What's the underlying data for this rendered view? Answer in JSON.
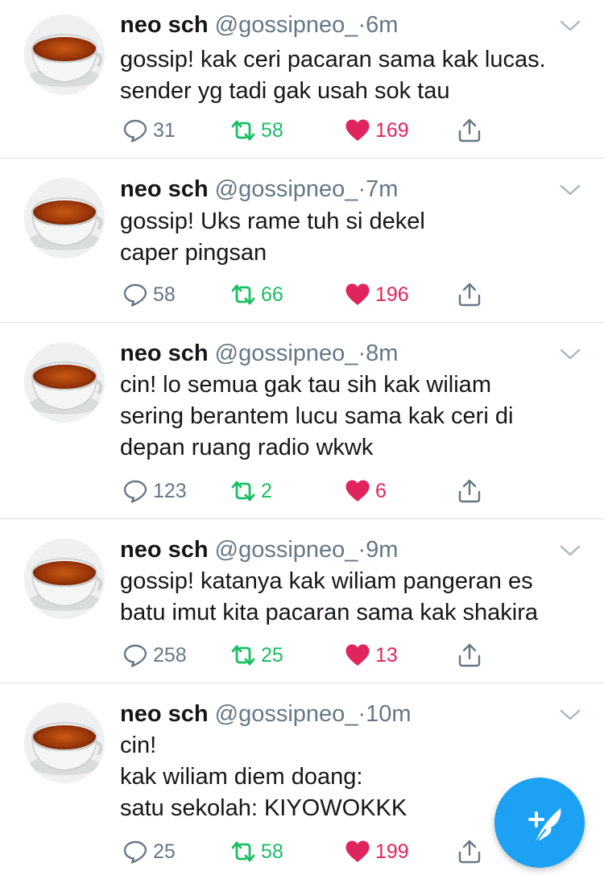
{
  "colors": {
    "accent": "#1da1f2",
    "retweet": "#17bf63",
    "like": "#e0245e",
    "muted": "#657786",
    "text": "#14171a",
    "divider": "#dadfe3"
  },
  "tweets": [
    {
      "name": "neo sch",
      "handle": "@gossipneo_",
      "dot": "·",
      "time": "6m",
      "lines": [
        "gossip! kak ceri pacaran sama kak lucas.",
        "sender yg tadi gak usah sok tau"
      ],
      "replies": "31",
      "retweets": "58",
      "likes": "169"
    },
    {
      "name": "neo sch",
      "handle": "@gossipneo_",
      "dot": "·",
      "time": "7m",
      "lines": [
        "gossip! Uks rame tuh si dekel",
        "caper pingsan"
      ],
      "replies": "58",
      "retweets": "66",
      "likes": "196"
    },
    {
      "name": "neo sch",
      "handle": "@gossipneo_",
      "dot": "·",
      "time": "8m",
      "lines": [
        "cin! lo semua gak tau sih kak wiliam",
        "sering berantem lucu sama kak ceri di",
        "depan ruang radio wkwk"
      ],
      "replies": "123",
      "retweets": "2",
      "likes": "6"
    },
    {
      "name": "neo sch",
      "handle": "@gossipneo_",
      "dot": "·",
      "time": "9m",
      "lines": [
        "gossip! katanya kak wiliam pangeran es",
        "batu imut kita pacaran sama kak shakira"
      ],
      "replies": "258",
      "retweets": "25",
      "likes": "13"
    },
    {
      "name": "neo sch",
      "handle": "@gossipneo_",
      "dot": "·",
      "time": "10m",
      "lines": [
        "cin!",
        "kak wiliam diem doang:",
        "satu sekolah: KIYOWOKKK"
      ],
      "replies": "25",
      "retweets": "58",
      "likes": "199"
    }
  ],
  "icons": {
    "reply": "reply-icon",
    "retweet": "retweet-icon",
    "like": "heart-icon",
    "share": "share-icon",
    "menu": "chevron-down-icon",
    "compose": "compose-tweet-icon",
    "avatar": "tea-cup-avatar"
  }
}
